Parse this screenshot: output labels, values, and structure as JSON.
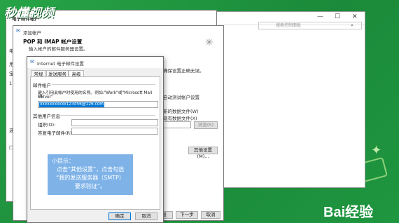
{
  "watermark": {
    "top_left": "秒懂视频",
    "bottom_right": "Bai经验"
  },
  "back_window": {
    "search_placeholder": "搜索控制面板",
    "controls": {
      "minimize": "—",
      "maximize": "☐",
      "close": "✕"
    }
  },
  "mail_window": {
    "title": "电子邮件帐户",
    "left_text": [
      "电子",
      "用",
      "宝",
      "1",
      "选",
      "□"
    ],
    "right_text": {
      "correct": "确保设置正确无误。",
      "test": "自动测试帐户设置",
      "new_file": "新的数据文件(W)",
      "existing_file": "现有数据文件(X)",
      "browse": "浏览(S)",
      "more_settings": "其他设置(M)..."
    },
    "bottom_buttons": {
      "back": "后退",
      "next": "下一步",
      "cancel": "取消"
    }
  },
  "account_window": {
    "title": "添加帐户",
    "heading": "POP 和 IMAP 帐户设置",
    "subheading": "输入帐户的邮件服务器设置。"
  },
  "dialog": {
    "title": "Internet 电子邮件设置",
    "tabs": [
      "常规",
      "发送服务器",
      "高级"
    ],
    "active_tab": 2,
    "mail_account_label": "邮件帐户",
    "mail_account_hint": "键入引用此帐户时使用的名称。例如:\"Work\"或\"Microsoft Mail Server\"",
    "mail_account_n": "(N)",
    "mail_account_value": "xxxxxxxxxxx123456@126.com",
    "other_user_info": "其他用户信息",
    "org_label": "组织(O):",
    "reply_label": "答复电子邮件(R):",
    "ok": "确定",
    "cancel": "取消"
  },
  "tip": {
    "title": "小提示：",
    "lines": [
      "点击“其他设置”，点击勾选",
      "“我的发送服务器（SMTP）",
      "要求验证”。"
    ]
  },
  "colors": {
    "background": "#1f9640",
    "tip": "#7fb3e8",
    "selection": "#0078d7"
  }
}
